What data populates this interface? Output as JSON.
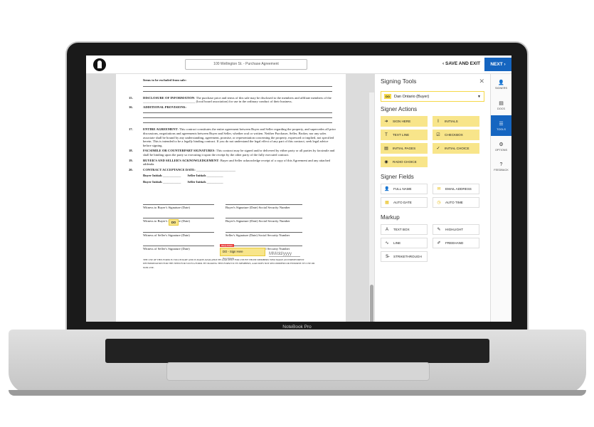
{
  "device": {
    "label": "NoteBook Pro"
  },
  "header": {
    "document_title": "100 Wellington St. - Purchase Agreement",
    "save_exit": "SAVE AND EXIT",
    "next": "NEXT"
  },
  "document": {
    "items_excluded": "Items to be excluded from sale:",
    "sections": [
      {
        "num": "15.",
        "title": "DISCLOSURE OF INFORMATION",
        "text": ": The purchase price and terms of this sale may be disclosed to the members and affiliate members of the ________________________________ (local board association) for use in the ordinary conduct of their business."
      },
      {
        "num": "16.",
        "title": "ADDITIONAL PROVISIONS:",
        "text": ""
      },
      {
        "num": "17.",
        "title": "ENTIRE AGREEMENT",
        "text": ": This contract constitutes the entire agreement between Buyer and Seller regarding the property, and supercedes all prior discussions, negotiations and agreements between Buyer and Seller, whether oral or written. Neither Purchaser, Seller, Broker, nor any sales associate shall be bound by any understanding, agreement, promise, or representation concerning the property, expressed or implied, not specified herein. This is intended to be a legally binding contract. If you do not understand the legal effect of any part of this contract, seek legal advice before signing."
      },
      {
        "num": "18.",
        "title": "FACSIMILE OR COUNTERPART SIGNATURES",
        "text": ": This contract may be signed and/or delivered by either party or all parties by facsimile and shall be binding upon the party so executing it upon the receipt by the other party of the fully executed contract."
      },
      {
        "num": "19.",
        "title": "BUYER'S AND SELLER'S ACKNOWLEDGEMENT",
        "text": ": Buyer and Seller acknowledge receipt of a copy of this Agreement and any attached addenda."
      },
      {
        "num": "20.",
        "title": "CONTRACT ACCEPTANCE DATE:",
        "text": ""
      }
    ],
    "buyer_initials": "Buyer Initials",
    "seller_initials": "Seller Initials",
    "initials_field": "DO",
    "required_tag": "REQUIRED",
    "sign_here_field": "DO - Sign Here",
    "signer_name_small": "Dan Ontario",
    "date_placeholder": "MM/dd/yyyy",
    "sig_lines": [
      {
        "left": "Witness to Buyer's Signature (Date)",
        "right": "Buyer's Signature (Date) Social Security Number"
      },
      {
        "left": "Witness to Buyer's Signature (Date)",
        "right": "Buyer's Signature (Date) Social Security Number"
      },
      {
        "left": "Witness of Seller's Signature (Date)",
        "right": "Seller's Signature (Date) Social Security Number"
      },
      {
        "left": "Witness of Seller's Signature (Date)",
        "right": "Seller's Signature (Date) Social Security Number"
      }
    ],
    "footer": "THE USE OF THIS FORM IS VOLUNTARY AND IS MADE AVAILABLE BY AAR ONLY FOR USE BY THOSE MEMBERS WHO MAKE AN INDEPENDENT DETERMINATION FOR THE NEED FOR SUCH A FORM. BY MAKING THIS FORM TO ITS MEMBERS, AAR DOES NOT RECOMMEND OR ENDORSE ITS USE OR NON-USE."
  },
  "tools": {
    "title": "Signing Tools",
    "signer": {
      "badge": "DO",
      "name": "Dan Ontario (Buyer)"
    },
    "signer_actions_title": "Signer Actions",
    "signer_actions": [
      {
        "label": "SIGN HERE",
        "icon": "➜"
      },
      {
        "label": "INITIALS",
        "icon": "I"
      },
      {
        "label": "TEXT LINE",
        "icon": "T"
      },
      {
        "label": "CHECKBOX",
        "icon": "☑"
      },
      {
        "label": "INITIAL PAGES",
        "icon": "▤"
      },
      {
        "label": "INITIAL CHOICE",
        "icon": "✓"
      },
      {
        "label": "RADIO CHOICE",
        "icon": "◉"
      }
    ],
    "signer_fields_title": "Signer Fields",
    "signer_fields": [
      {
        "label": "FULL NAME",
        "icon": "👤"
      },
      {
        "label": "EMAIL ADDRESS",
        "icon": "✉"
      },
      {
        "label": "AUTO DATE",
        "icon": "▦"
      },
      {
        "label": "AUTO TIME",
        "icon": "◷"
      }
    ],
    "markup_title": "Markup",
    "markup": [
      {
        "label": "TEXT BOX",
        "icon": "A"
      },
      {
        "label": "HIGHLIGHT",
        "icon": "✎"
      },
      {
        "label": "LINE",
        "icon": "∿"
      },
      {
        "label": "FREEHAND",
        "icon": "✐"
      },
      {
        "label": "STRIKETHROUGH",
        "icon": "S̶"
      }
    ]
  },
  "rail": [
    {
      "label": "SIGNERS",
      "icon": "👤"
    },
    {
      "label": "DOCS",
      "icon": "▤"
    },
    {
      "label": "TOOLS",
      "icon": "☰",
      "active": true
    },
    {
      "label": "OPTIONS",
      "icon": "⚙"
    },
    {
      "label": "FEEDBACK",
      "icon": "?"
    }
  ],
  "colors": {
    "accent": "#1565c0",
    "field_yellow": "#f8e58a",
    "required_red": "#e53935"
  }
}
